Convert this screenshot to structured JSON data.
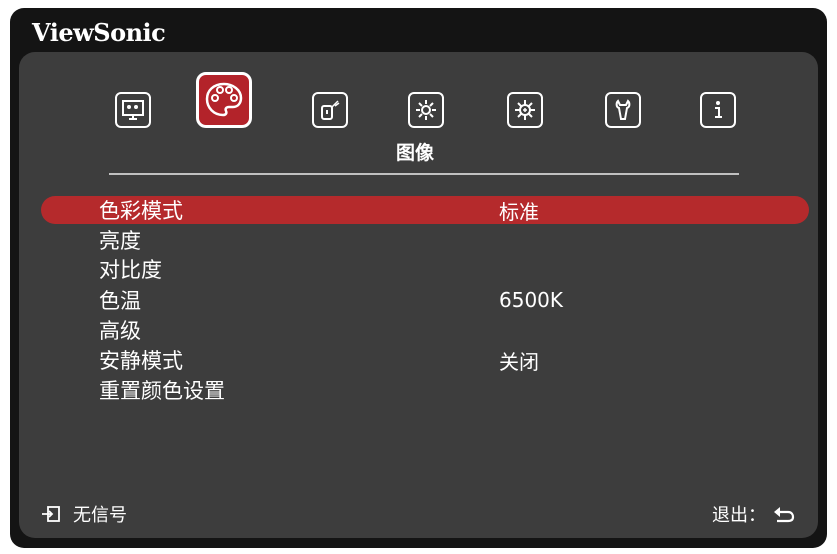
{
  "brand": {
    "logo_text": "ViewSonic"
  },
  "tabs": {
    "icons": [
      "display-icon",
      "palette-icon",
      "power-icon",
      "settings-icon",
      "advanced-settings-icon",
      "wrench-icon",
      "info-icon"
    ],
    "active_label": "图像"
  },
  "menu": {
    "items": [
      {
        "label": "色彩模式",
        "value": "标准"
      },
      {
        "label": "亮度",
        "value": ""
      },
      {
        "label": "对比度",
        "value": ""
      },
      {
        "label": "色温",
        "value": "6500K"
      },
      {
        "label": "高级",
        "value": ""
      },
      {
        "label": "安静模式",
        "value": "关闭"
      },
      {
        "label": "重置颜色设置",
        "value": ""
      }
    ]
  },
  "footer": {
    "signal_text": "无信号",
    "exit_text": "退出："
  },
  "colors": {
    "accent": "#b52a2c",
    "panel": "#3d3d3d",
    "frame": "#141414"
  }
}
